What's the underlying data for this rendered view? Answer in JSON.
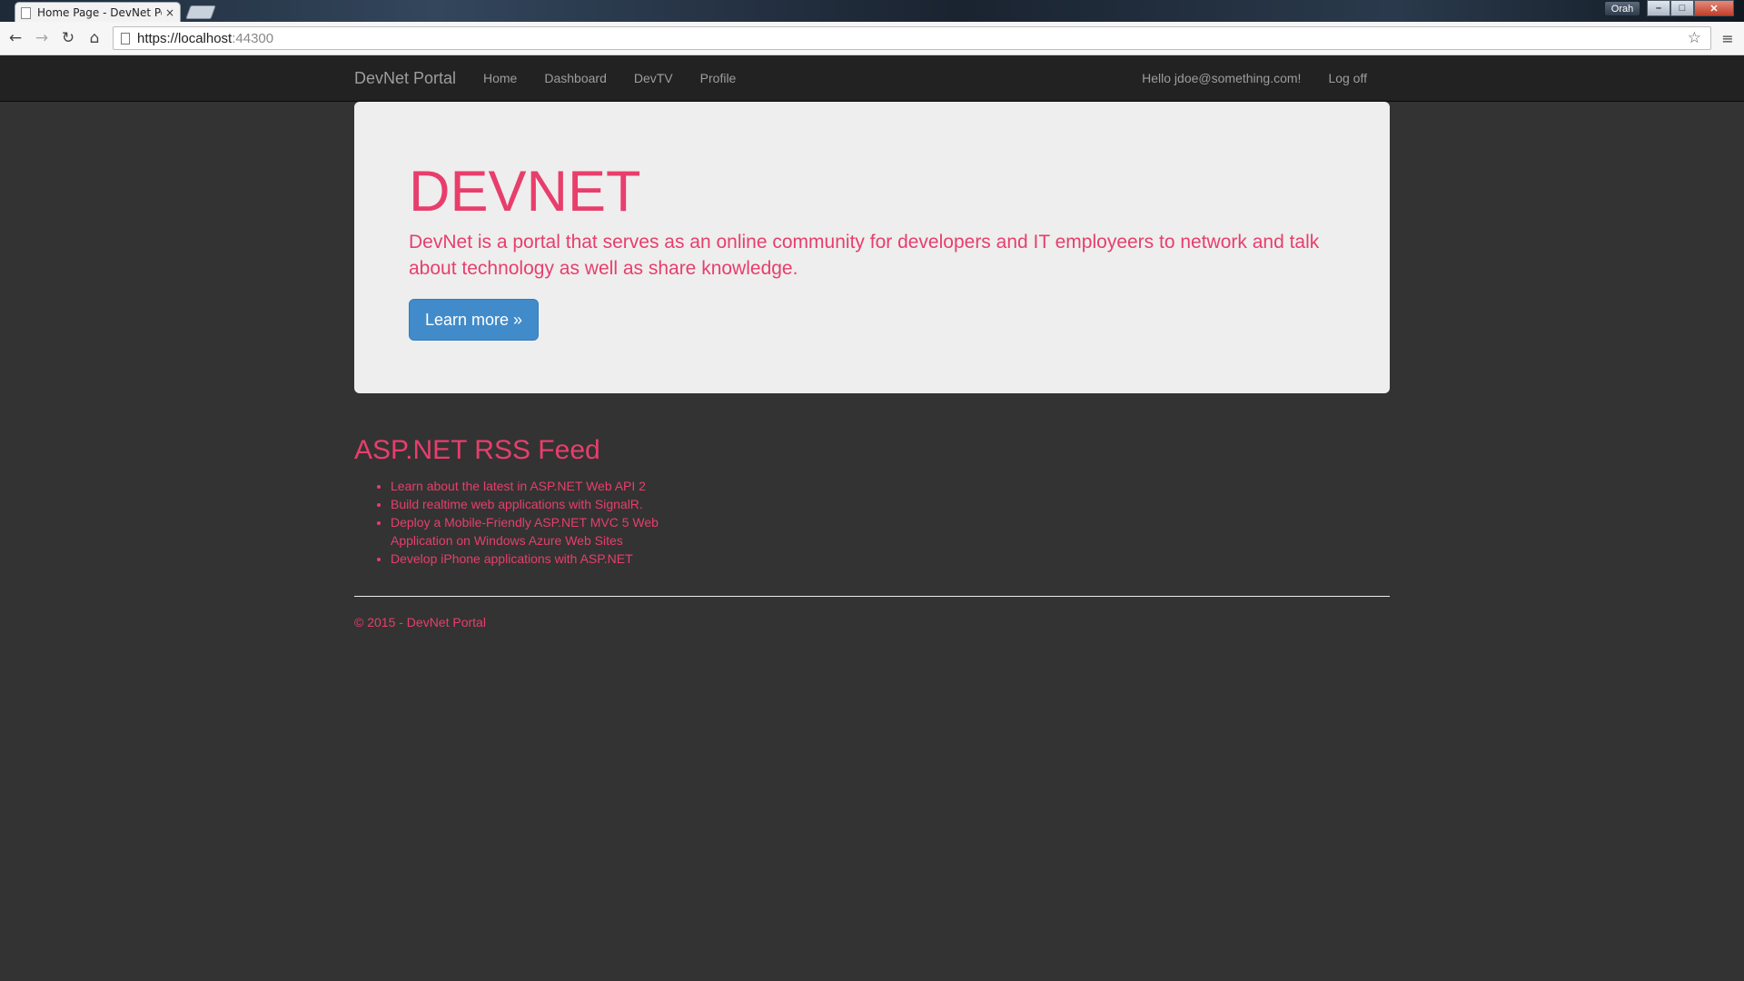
{
  "browser": {
    "tab_title": "Home Page - DevNet Por",
    "tab_close": "×",
    "user_badge": "Orah",
    "window_controls": {
      "minimize": "–",
      "maximize": "□",
      "close": "✕"
    },
    "url_main": "https://localhost",
    "url_port": ":44300",
    "icons": {
      "back": "←",
      "forward": "→",
      "reload": "↻",
      "home": "⌂",
      "star": "☆",
      "menu": "≡"
    }
  },
  "navbar": {
    "brand": "DevNet Portal",
    "links": [
      {
        "label": "Home"
      },
      {
        "label": "Dashboard"
      },
      {
        "label": "DevTV"
      },
      {
        "label": "Profile"
      }
    ],
    "greeting": "Hello jdoe@something.com!",
    "logoff": "Log off"
  },
  "jumbotron": {
    "title": "DEVNET",
    "lead": "DevNet is a portal that serves as an online community for developers and IT employeers to network and talk about technology as well as share knowledge.",
    "button": "Learn more »"
  },
  "rss": {
    "title": "ASP.NET RSS Feed",
    "items": [
      "Learn about the latest in ASP.NET Web API 2",
      "Build realtime web applications with SignalR.",
      "Deploy a Mobile-Friendly ASP.NET MVC 5 Web Application on Windows Azure Web Sites",
      "Develop iPhone applications with ASP.NET"
    ]
  },
  "footer": {
    "text": "© 2015 - DevNet Portal"
  },
  "colors": {
    "accent": "#e83e6c",
    "page_bg": "#333333",
    "navbar_bg": "#222222",
    "jumbotron_bg": "#eeeeee",
    "button_bg": "#428bca"
  }
}
